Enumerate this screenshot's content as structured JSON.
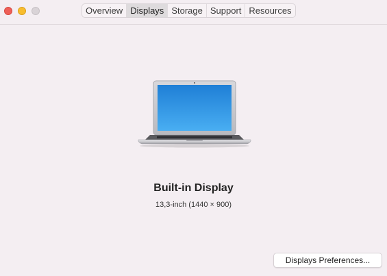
{
  "window": {
    "controls": [
      "close",
      "minimize",
      "zoom"
    ]
  },
  "tabs": [
    {
      "label": "Overview",
      "active": false
    },
    {
      "label": "Displays",
      "active": true
    },
    {
      "label": "Storage",
      "active": false
    },
    {
      "label": "Support",
      "active": false
    },
    {
      "label": "Resources",
      "active": false
    }
  ],
  "display": {
    "image": "laptop-icon",
    "name": "Built-in Display",
    "details": "13,3-inch (1440 × 900)"
  },
  "actions": {
    "preferences_label": "Displays Preferences..."
  },
  "colors": {
    "background": "#f4eef2",
    "close": "#ee5f58",
    "minimize": "#f8bd2e",
    "zoom_inactive": "#d9d3d7",
    "screen_blue": "#2f8fe0"
  }
}
